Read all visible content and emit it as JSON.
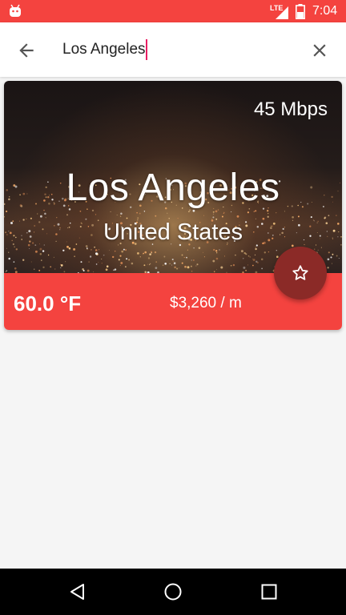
{
  "status_bar": {
    "network": "LTE",
    "time": "7:04"
  },
  "search": {
    "query": "Los Angeles",
    "icons": {
      "back": "arrow-left-icon",
      "clear": "close-icon"
    }
  },
  "city_card": {
    "bandwidth": "45 Mbps",
    "city": "Los Angeles",
    "country": "United States",
    "temperature": "60.0 °F",
    "cost": "$3,260 / m",
    "favorite_icon": "star-outline-icon"
  },
  "nav_bar": {
    "icons": [
      "back-triangle-icon",
      "home-circle-icon",
      "recents-square-icon"
    ]
  },
  "colors": {
    "accent_red": "#f4433f",
    "fab_dark_red": "#8b2a27",
    "cursor_pink": "#e91e63"
  }
}
